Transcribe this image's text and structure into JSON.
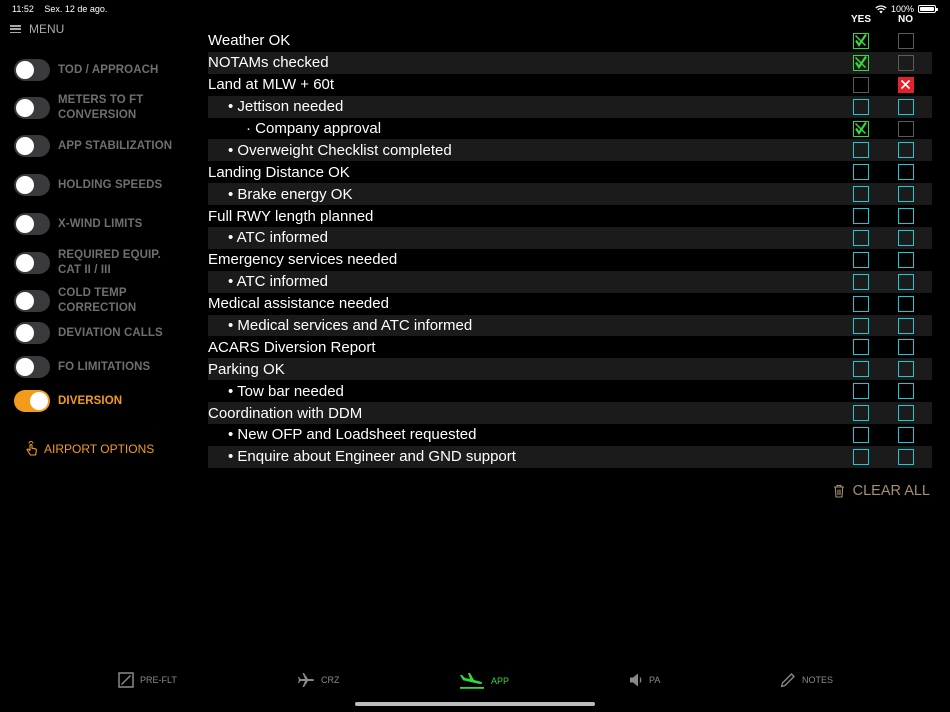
{
  "status": {
    "time": "11:52",
    "date": "Sex. 12 de ago.",
    "battery": "100%",
    "battery_level": 1.0
  },
  "menu": {
    "label": "MENU"
  },
  "sidebar": {
    "items": [
      {
        "label": "TOD / APPROACH",
        "on": false
      },
      {
        "label": "METERS TO FT CONVERSION",
        "on": false
      },
      {
        "label": "APP STABILIZATION",
        "on": false
      },
      {
        "label": "HOLDING SPEEDS",
        "on": false
      },
      {
        "label": "X-WIND LIMITS",
        "on": false
      },
      {
        "label": "REQUIRED EQUIP. CAT II / III",
        "on": false
      },
      {
        "label": "COLD TEMP CORRECTION",
        "on": false
      },
      {
        "label": "DEVIATION CALLS",
        "on": false
      },
      {
        "label": "FO LIMITATIONS",
        "on": false
      },
      {
        "label": "DIVERSION",
        "on": true
      }
    ],
    "airport_options": "AIRPORT OPTIONS"
  },
  "checklist": {
    "yes_label": "YES",
    "no_label": "NO",
    "rows": [
      {
        "label": "Weather OK",
        "yes": "checked",
        "no": "neutral"
      },
      {
        "label": "NOTAMs checked",
        "yes": "checked",
        "no": "neutral"
      },
      {
        "label": "Land at MLW + 60t",
        "yes": "neutral",
        "no": "crossed"
      },
      {
        "label": "• Jettison needed",
        "yes": "empty",
        "no": "empty"
      },
      {
        "label": "· Company approval",
        "yes": "checked",
        "no": "neutral"
      },
      {
        "label": "• Overweight Checklist completed",
        "yes": "empty",
        "no": "empty"
      },
      {
        "label": "Landing Distance OK",
        "yes": "empty",
        "no": "empty"
      },
      {
        "label": "• Brake energy OK",
        "yes": "empty",
        "no": "empty"
      },
      {
        "label": "Full RWY length planned",
        "yes": "empty",
        "no": "empty"
      },
      {
        "label": "• ATC informed",
        "yes": "empty",
        "no": "empty"
      },
      {
        "label": "Emergency services needed",
        "yes": "empty",
        "no": "empty"
      },
      {
        "label": "• ATC informed",
        "yes": "empty",
        "no": "empty"
      },
      {
        "label": "Medical assistance needed",
        "yes": "empty",
        "no": "empty"
      },
      {
        "label": "• Medical services and ATC informed",
        "yes": "empty",
        "no": "empty"
      },
      {
        "label": "ACARS Diversion Report",
        "yes": "empty",
        "no": "empty"
      },
      {
        "label": "Parking OK",
        "yes": "empty",
        "no": "empty"
      },
      {
        "label": "• Tow bar needed",
        "yes": "empty",
        "no": "empty"
      },
      {
        "label": "Coordination with DDM",
        "yes": "empty",
        "no": "empty"
      },
      {
        "label": "• New OFP and Loadsheet requested",
        "yes": "empty",
        "no": "empty"
      },
      {
        "label": "• Enquire about Engineer and GND support",
        "yes": "empty",
        "no": "empty"
      }
    ],
    "clear_all": "CLEAR ALL"
  },
  "tabs": [
    {
      "label": "PRE-FLT",
      "icon": "checkbox-icon",
      "active": false
    },
    {
      "label": "CRZ",
      "icon": "airplane-icon",
      "active": false
    },
    {
      "label": "APP",
      "icon": "landing-icon",
      "active": true
    },
    {
      "label": "PA",
      "icon": "speaker-icon",
      "active": false
    },
    {
      "label": "NOTES",
      "icon": "pencil-icon",
      "active": false
    }
  ],
  "colors": {
    "accent_orange": "#f39c1b",
    "check_green": "#35d83b",
    "cross_red": "#e2222a",
    "empty_cyan": "#1fc7d4",
    "clear_all_tan": "#a58f72"
  }
}
